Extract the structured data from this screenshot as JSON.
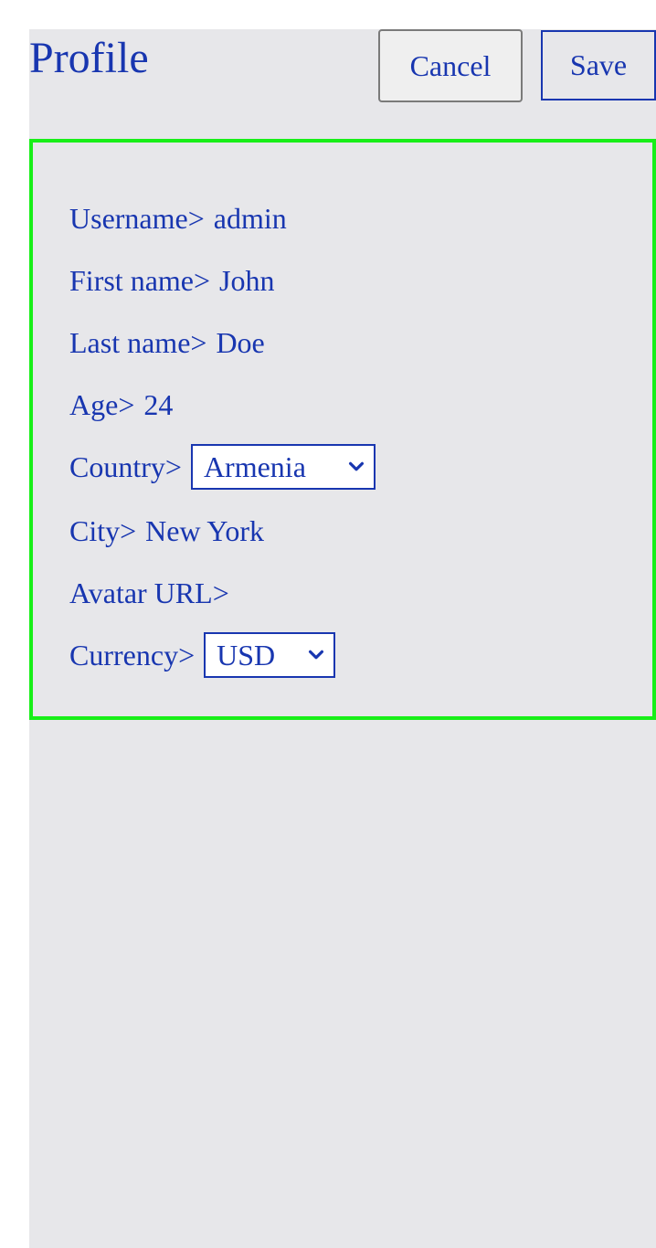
{
  "header": {
    "title": "Profile",
    "cancel_label": "Cancel",
    "save_label": "Save"
  },
  "form": {
    "username": {
      "label": "Username>",
      "value": "admin"
    },
    "first_name": {
      "label": "First name>",
      "value": "John"
    },
    "last_name": {
      "label": "Last name>",
      "value": "Doe"
    },
    "age": {
      "label": "Age>",
      "value": "24"
    },
    "country": {
      "label": "Country>",
      "selected": "Armenia"
    },
    "city": {
      "label": "City>",
      "value": "New York"
    },
    "avatar_url": {
      "label": "Avatar URL>",
      "value": ""
    },
    "currency": {
      "label": "Currency>",
      "selected": "USD"
    }
  },
  "colors": {
    "text": "#1836b0",
    "panel_border": "#18ef18",
    "background": "#e7e7ea"
  },
  "icons": {
    "select_arrow": "chevron-down-icon"
  }
}
